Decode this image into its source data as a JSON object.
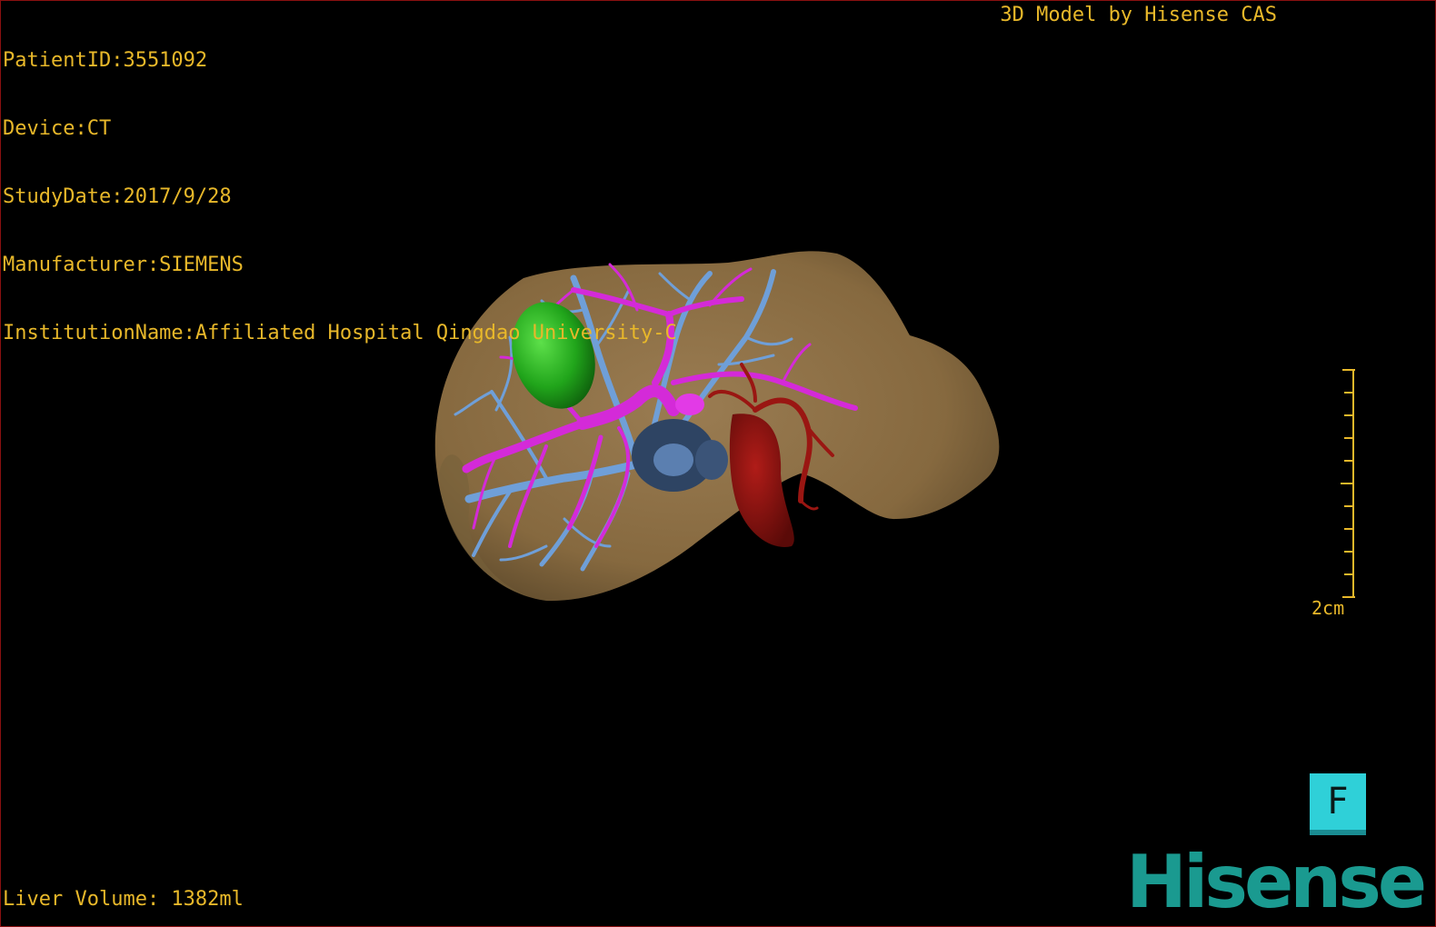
{
  "patient_info": {
    "patient_id": "PatientID:3551092",
    "device": "Device:CT",
    "study_date": "StudyDate:2017/9/28",
    "manufacturer": "Manufacturer:SIEMENS",
    "institution": "InstitutionName:Affiliated Hospital Qingdao University-C"
  },
  "credit": "3D Model by Hisense CAS",
  "liver_volume": "Liver Volume: 1382ml",
  "scale": {
    "label": "2cm"
  },
  "orientation_label": "F",
  "brand": "Hisense",
  "colors": {
    "overlay_text": "#e8b82a",
    "liver": "#8a6e47",
    "tumor": "#22a51e",
    "portal_vein": "#d42ad8",
    "hepatic_vein": "#6f9fd8",
    "artery": "#8c1410",
    "brand": "#1a9a90",
    "orientation_cube": "#2fd0d8"
  },
  "structures": [
    "liver",
    "tumor",
    "portal-vein",
    "hepatic-vein",
    "hepatic-artery",
    "inferior-vena-cava"
  ]
}
